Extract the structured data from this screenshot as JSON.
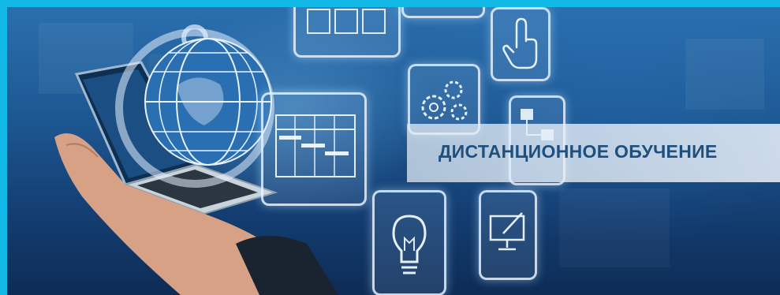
{
  "banner": {
    "caption": "ДИСТАНЦИОННОЕ ОБУЧЕНИЕ",
    "border_color": "#12b8e6",
    "caption_color": "#1f4f7d",
    "icons": [
      "schedule-chart-icon",
      "gears-icon",
      "pointing-hand-icon",
      "flowchart-icon",
      "lightbulb-icon",
      "monitor-pen-icon",
      "globe-icon",
      "laptop-icon"
    ]
  }
}
